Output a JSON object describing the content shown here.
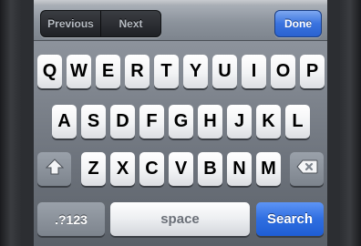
{
  "form_bar": {
    "previous_label": "Previous",
    "next_label": "Next",
    "done_label": "Done"
  },
  "keyboard": {
    "row1": [
      "Q",
      "W",
      "E",
      "R",
      "T",
      "Y",
      "U",
      "I",
      "O",
      "P"
    ],
    "row2": [
      "A",
      "S",
      "D",
      "F",
      "G",
      "H",
      "J",
      "K",
      "L"
    ],
    "row3": [
      "Z",
      "X",
      "C",
      "V",
      "B",
      "N",
      "M"
    ],
    "shift_icon": "shift-arrow-icon",
    "delete_icon": "backspace-icon",
    "numbers_label": ".?123",
    "space_label": "space",
    "search_label": "Search"
  },
  "colors": {
    "accent_blue": "#2f6ee0",
    "keyboard_bg": "#6f757e"
  }
}
